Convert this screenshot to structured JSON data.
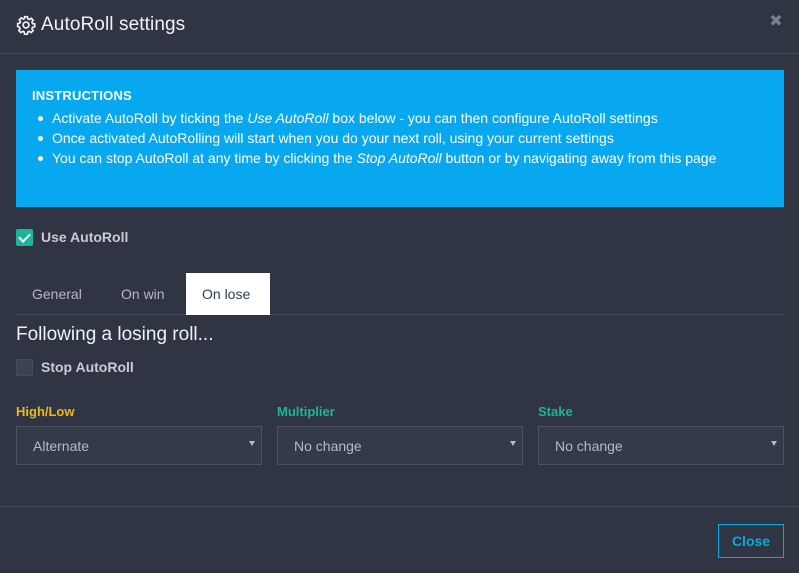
{
  "header": {
    "title": "AutoRoll settings",
    "icon": "gear-icon",
    "close_icon": "close-icon",
    "close_glyph": "✖"
  },
  "instructions": {
    "heading": "INSTRUCTIONS",
    "items": [
      {
        "pre": "Activate AutoRoll by ticking the ",
        "em": "Use AutoRoll",
        "post": " box below - you can then configure AutoRoll settings"
      },
      {
        "pre": "Once activated AutoRolling will start when you do your next roll, using your current settings",
        "em": "",
        "post": ""
      },
      {
        "pre": "You can stop AutoRoll at any time by clicking the ",
        "em": "Stop AutoRoll",
        "post": " button or by navigating away from this page"
      }
    ],
    "color": "#08a8f0"
  },
  "use_autoroll": {
    "label": "Use AutoRoll",
    "checked": true
  },
  "tabs": [
    {
      "label": "General",
      "active": false
    },
    {
      "label": "On win",
      "active": false
    },
    {
      "label": "On lose",
      "active": true
    }
  ],
  "section": {
    "title": "Following a losing roll...",
    "stop_label": "Stop AutoRoll",
    "stop_checked": false
  },
  "fields": [
    {
      "label": "High/Low",
      "value": "Alternate",
      "color": "#f0b81e"
    },
    {
      "label": "Multiplier",
      "value": "No change",
      "color": "#1eb39c"
    },
    {
      "label": "Stake",
      "value": "No change",
      "color": "#1eb39c"
    }
  ],
  "footer": {
    "close_label": "Close",
    "accent": "#09a6e5"
  }
}
